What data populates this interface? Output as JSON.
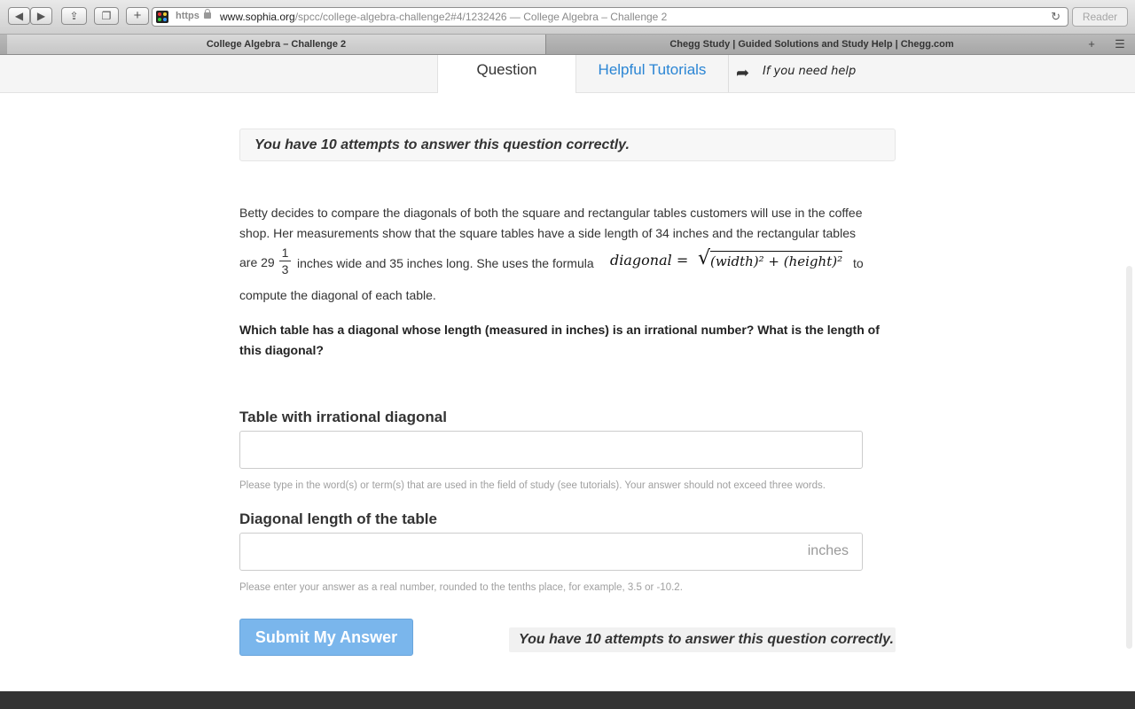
{
  "browser": {
    "nav_back_icon": "back-arrow-icon",
    "nav_forward_icon": "forward-arrow-icon",
    "address": {
      "scheme": "https",
      "domain": "www.sophia.org",
      "path": "/spcc/college-algebra-challenge2#4/1232426",
      "title_suffix": " — College Algebra – Challenge 2"
    },
    "reader_label": "Reader",
    "tabs": [
      {
        "label": "College Algebra – Challenge 2",
        "active": true
      },
      {
        "label": "Chegg Study | Guided Solutions and Study Help | Chegg.com",
        "active": false
      }
    ]
  },
  "page": {
    "tabs": {
      "question": "Question",
      "tutorials": "Helpful Tutorials",
      "help_note": "If you need help"
    },
    "attempts_notice": "You have 10 attempts to answer this question correctly.",
    "problem": {
      "line1": "Betty decides to compare the diagonals of both the square and rectangular tables customers will use in the coffee",
      "line2": "shop.  Her measurements show that the square tables have a side length of 34 inches and the rectangular tables",
      "line3_pre": "are 29",
      "frac_num": "1",
      "frac_den": "3",
      "line3_mid": "inches wide and 35 inches long. She uses the formula",
      "formula_lhs": "diagonal  =",
      "formula_radicand": "(width)² + (height)²",
      "line3_post": "to",
      "line4": "compute the diagonal of each table."
    },
    "question_bold": "Which table has a diagonal whose length (measured in inches) is an irrational number? What is the length of this diagonal?",
    "field1": {
      "label": "Table with irrational diagonal",
      "value": "",
      "hint": "Please type in the word(s) or term(s) that are used in the field of study (see tutorials). Your answer should not exceed three words."
    },
    "field2": {
      "label": "Diagonal length of the table",
      "value": "",
      "unit": "inches",
      "hint": "Please enter your answer as a real number, rounded to the tenths place, for example, 3.5 or -10.2."
    },
    "submit_label": "Submit My Answer",
    "colors": {
      "accent": "#2a85d4",
      "submit": "#7ab6ec",
      "footer": "#343434"
    }
  }
}
